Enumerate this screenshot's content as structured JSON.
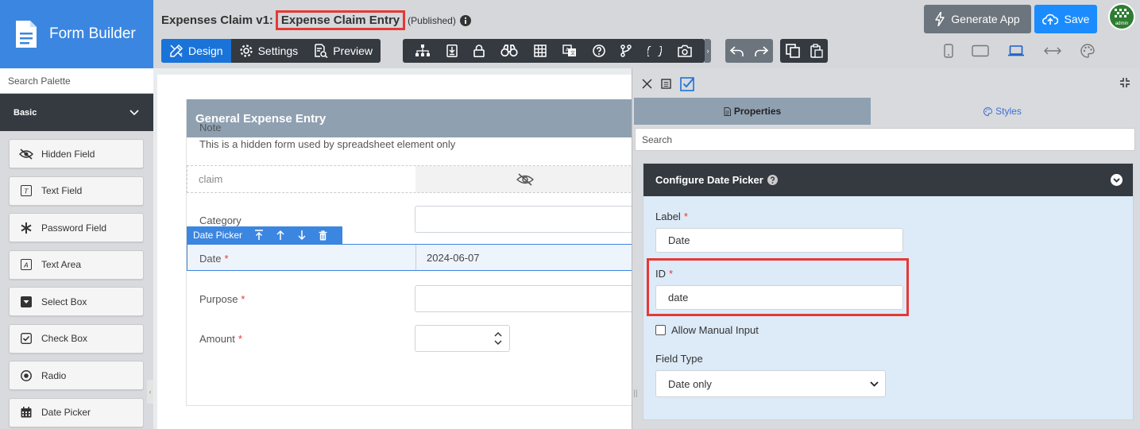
{
  "app": {
    "brand": "Form Builder"
  },
  "sidebar": {
    "search_placeholder": "Search Palette",
    "category": "Basic",
    "items": [
      {
        "label": "Hidden Field",
        "icon": "eye-slash-icon"
      },
      {
        "label": "Text Field",
        "icon": "text-field-icon"
      },
      {
        "label": "Password Field",
        "icon": "asterisk-icon"
      },
      {
        "label": "Text Area",
        "icon": "text-area-icon"
      },
      {
        "label": "Select Box",
        "icon": "select-box-icon"
      },
      {
        "label": "Check Box",
        "icon": "check-box-icon"
      },
      {
        "label": "Radio",
        "icon": "radio-icon"
      },
      {
        "label": "Date Picker",
        "icon": "calendar-icon"
      }
    ]
  },
  "header": {
    "title_prefix": "Expenses Claim v1:",
    "form_name": "Expense Claim Entry",
    "status": "(Published)",
    "generate_label": "Generate App",
    "save_label": "Save",
    "avatar_label": "admin"
  },
  "modes": {
    "design": "Design",
    "settings": "Settings",
    "preview": "Preview"
  },
  "canvas": {
    "section_title": "General Expense Entry",
    "note_label": "Note",
    "note_text": "This is a hidden form used by spreadsheet element only",
    "hidden_field_label": "claim",
    "category_label": "Category",
    "picker_toolbar_label": "Date Picker",
    "date_label": "Date",
    "date_value": "2024-06-07",
    "purpose_label": "Purpose",
    "amount_label": "Amount",
    "required_mark": "*"
  },
  "panel": {
    "tab_properties": "Properties",
    "tab_styles": "Styles",
    "search_placeholder": "Search",
    "config_title": "Configure Date Picker",
    "label_field_label": "Label",
    "label_field_value": "Date",
    "id_field_label": "ID",
    "id_field_value": "date",
    "allow_manual_input": "Allow Manual Input",
    "field_type_label": "Field Type",
    "field_type_value": "Date only",
    "required_mark": "*"
  },
  "colors": {
    "brand_blue": "#3b86e0",
    "dark": "#343a40",
    "highlight_red": "#e53935",
    "section_header": "#8fa0b1"
  }
}
